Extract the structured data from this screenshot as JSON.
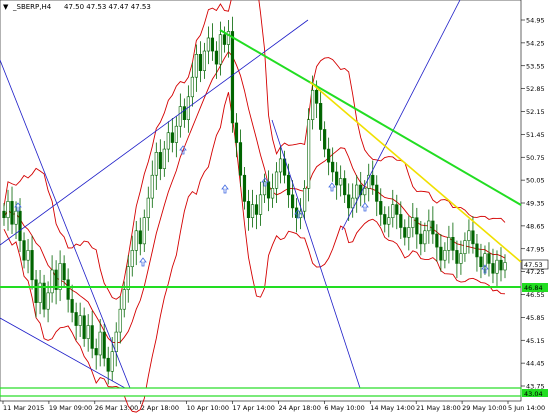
{
  "header": {
    "dropdown_glyph": "▼",
    "symbol_timeframe": "_SBERP,H4",
    "ohlc": "47.50 47.53 47.47 47.53"
  },
  "price_axis": {
    "labels": [
      "54.95",
      "54.25",
      "53.55",
      "52.85",
      "52.15",
      "51.45",
      "50.75",
      "50.05",
      "49.35",
      "48.65",
      "47.95",
      "47.25",
      "46.55",
      "45.85",
      "45.15",
      "44.45",
      "43.75"
    ],
    "current_price": "47.53",
    "level_price": "46.84",
    "bottom_level_price": "43.04"
  },
  "time_axis": {
    "labels": [
      "11 Mar 2015",
      "19 Mar 09:00",
      "26 Mar 13:00",
      "2 Apr 18:00",
      "10 Apr 10:00",
      "17 Apr 14:00",
      "24 Apr 18:00",
      "6 May 10:00",
      "14 May 14:00",
      "21 May 18:00",
      "29 May 10:00",
      "5 Jun 14:00"
    ]
  },
  "colors": {
    "background": "#ffffff",
    "candle": "#006400",
    "bollinger": "#d40000",
    "trendline_blue": "#1e1ec8",
    "trendline_yellow": "#f0e000",
    "trendline_green": "#22dd22",
    "level_line": "#22dd22",
    "fractal_arrow": "#4169e1"
  },
  "chart_data": {
    "type": "candlestick",
    "symbol": "_SBERP",
    "timeframe": "H4",
    "ylim": [
      43.4,
      55.5
    ],
    "close_series": [
      48.9,
      49.4,
      48.7,
      49.1,
      48.2,
      47.6,
      47.9,
      47.0,
      46.3,
      46.9,
      46.1,
      46.6,
      47.3,
      46.7,
      47.5,
      47.0,
      46.4,
      46.0,
      45.6,
      45.9,
      45.2,
      45.6,
      44.9,
      44.7,
      45.4,
      44.6,
      44.2,
      44.8,
      45.4,
      46.1,
      46.7,
      47.4,
      47.9,
      48.5,
      48.1,
      48.9,
      49.5,
      50.2,
      50.9,
      50.4,
      51.0,
      51.5,
      51.2,
      51.7,
      52.3,
      51.9,
      52.6,
      53.2,
      53.9,
      53.4,
      54.0,
      54.4,
      54.0,
      53.6,
      54.5,
      54.2,
      54.6,
      51.8,
      51.2,
      50.2,
      49.4,
      48.9,
      49.3,
      49.0,
      49.6,
      50.0,
      49.5,
      49.8,
      50.3,
      50.7,
      50.2,
      49.6,
      49.2,
      48.9,
      49.1,
      49.8,
      51.9,
      52.8,
      52.4,
      51.6,
      51.0,
      50.6,
      50.3,
      49.9,
      50.1,
      49.6,
      49.2,
      49.5,
      49.9,
      49.6,
      49.8,
      50.2,
      49.9,
      49.4,
      49.0,
      48.7,
      48.9,
      49.3,
      49.0,
      48.6,
      48.3,
      48.6,
      48.9,
      48.4,
      48.1,
      48.5,
      48.8,
      48.4,
      48.0,
      47.6,
      47.9,
      48.3,
      47.9,
      47.5,
      47.8,
      48.2,
      48.5,
      48.1,
      47.7,
      47.4,
      47.8,
      47.5,
      47.2,
      47.6,
      47.3,
      47.53
    ],
    "current_price": 47.53,
    "horizontal_level": 46.84,
    "trendlines": [
      {
        "color": "yellow",
        "from": [
          "6 May 10:00",
          52.95
        ],
        "to": [
          "5 Jun 14:00",
          47.9
        ]
      },
      {
        "color": "green",
        "from": [
          "17 Apr 14:00",
          54.75
        ],
        "to": [
          "5 Jun 14:00",
          49.5
        ]
      },
      {
        "color": "blue",
        "from": [
          "11 Mar 2015",
          47.1
        ],
        "to": [
          "17 Apr 14:00",
          54.9
        ]
      }
    ]
  }
}
